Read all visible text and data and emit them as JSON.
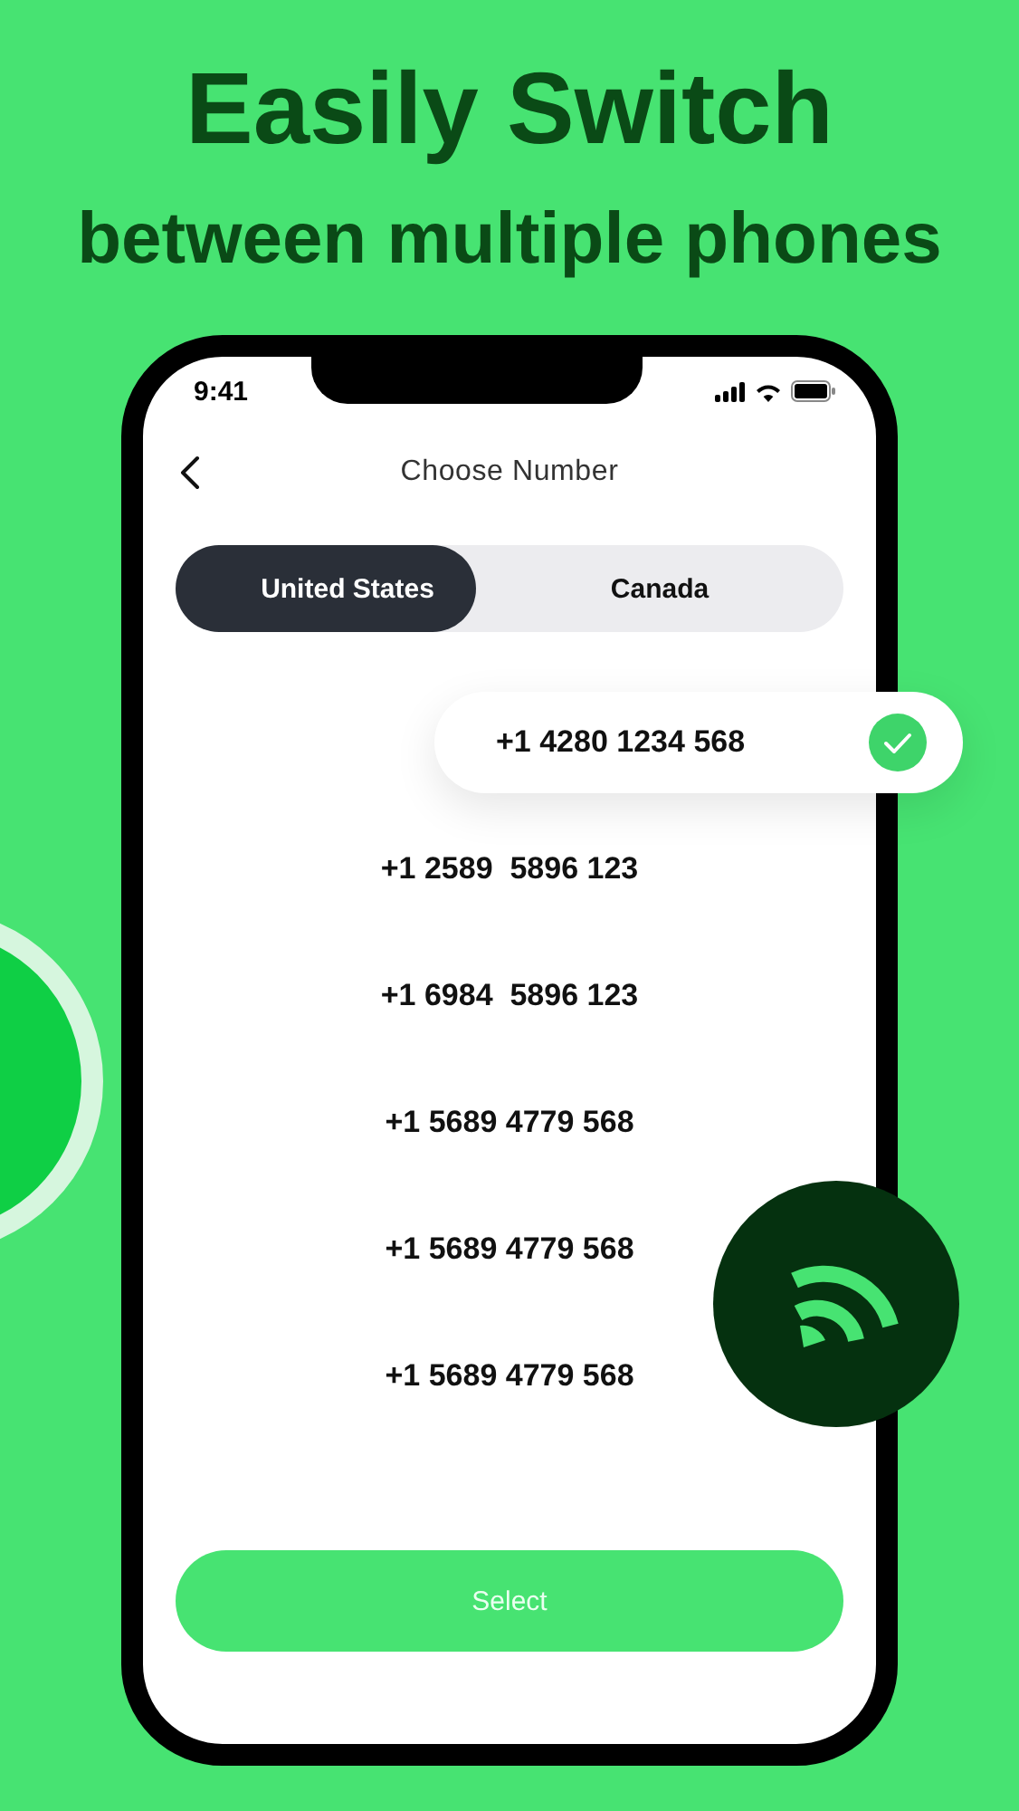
{
  "headline": [
    "Easily Switch",
    "between multiple phones"
  ],
  "status_bar": {
    "time": "9:41"
  },
  "header": {
    "title": "Choose Number"
  },
  "tabs": [
    {
      "label": "United States",
      "selected": true
    },
    {
      "label": "Canada",
      "selected": false
    }
  ],
  "numbers": [
    {
      "number": "+1 4280 1234 568",
      "selected": true
    },
    {
      "number": "+1 2589  5896 123",
      "selected": false
    },
    {
      "number": "+1 6984  5896 123",
      "selected": false
    },
    {
      "number": "+1 5689 4779 568",
      "selected": false
    },
    {
      "number": "+1 5689 4779 568",
      "selected": false
    },
    {
      "number": "+1 5689 4779 568",
      "selected": false
    }
  ],
  "button": {
    "label": "Select"
  }
}
